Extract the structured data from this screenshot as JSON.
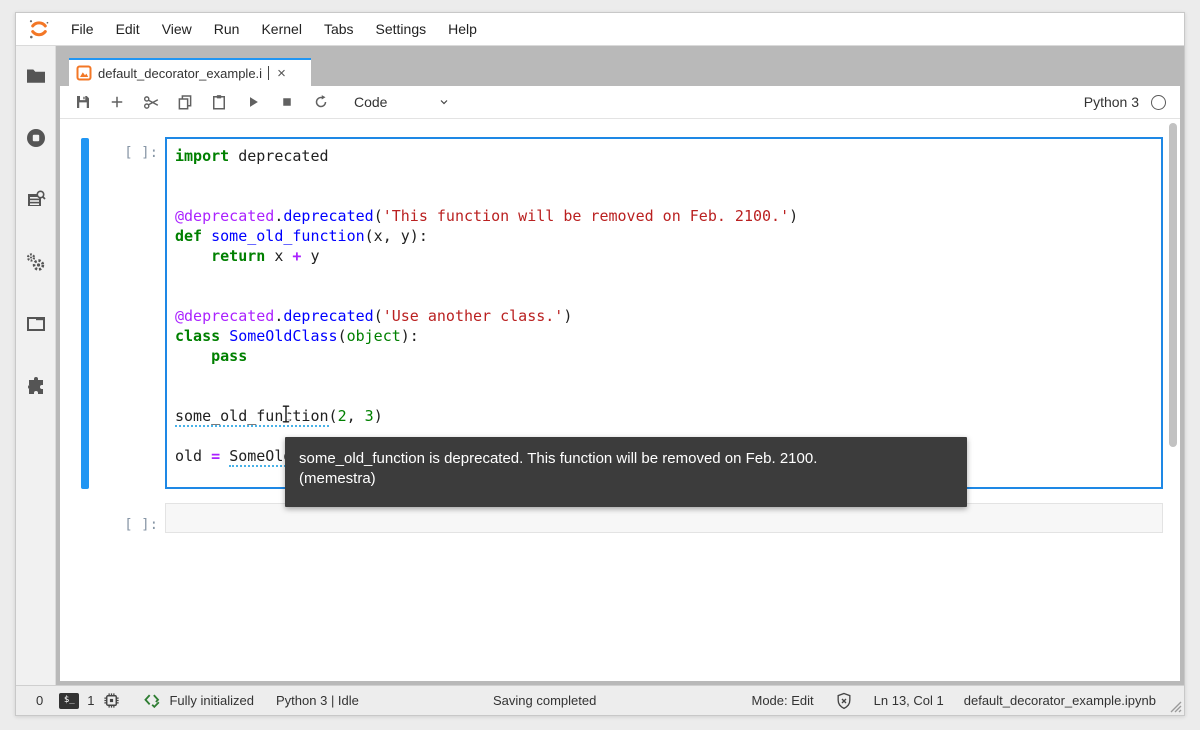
{
  "menubar": {
    "items": [
      "File",
      "Edit",
      "View",
      "Run",
      "Kernel",
      "Tabs",
      "Settings",
      "Help"
    ]
  },
  "tab": {
    "title": "default_decorator_example.i",
    "close": "×"
  },
  "toolbar": {
    "cell_type": "Code",
    "kernel_name": "Python 3",
    "icon_names": [
      "save",
      "insert-cell",
      "cut",
      "copy",
      "paste",
      "run",
      "stop",
      "restart-kernel"
    ]
  },
  "sidebar": {
    "icon_names": [
      "file-browser",
      "running-kernels",
      "inspector",
      "property-inspector",
      "open-tabs",
      "extensions"
    ]
  },
  "notebook": {
    "cells": [
      {
        "prompt": "[ ]:",
        "lines": [
          [
            {
              "t": "import",
              "c": "kw"
            },
            {
              "t": " deprecated",
              "c": "p"
            }
          ],
          [],
          [],
          [
            {
              "t": "@deprecated",
              "c": "dec"
            },
            {
              "t": ".",
              "c": "p"
            },
            {
              "t": "deprecated",
              "c": "d"
            },
            {
              "t": "(",
              "c": "p"
            },
            {
              "t": "'This function will be removed on Feb. 2100.'",
              "c": "s"
            },
            {
              "t": ")",
              "c": "p"
            }
          ],
          [
            {
              "t": "def",
              "c": "kw"
            },
            {
              "t": " ",
              "c": "p"
            },
            {
              "t": "some_old_function",
              "c": "d"
            },
            {
              "t": "(x, y):",
              "c": "p"
            }
          ],
          [
            {
              "t": "    ",
              "c": "p"
            },
            {
              "t": "return",
              "c": "kw"
            },
            {
              "t": " x ",
              "c": "p"
            },
            {
              "t": "+",
              "c": "o"
            },
            {
              "t": " y",
              "c": "p"
            }
          ],
          [],
          [],
          [
            {
              "t": "@deprecated",
              "c": "dec"
            },
            {
              "t": ".",
              "c": "p"
            },
            {
              "t": "deprecated",
              "c": "d"
            },
            {
              "t": "(",
              "c": "p"
            },
            {
              "t": "'Use another class.'",
              "c": "s"
            },
            {
              "t": ")",
              "c": "p"
            }
          ],
          [
            {
              "t": "class",
              "c": "kw"
            },
            {
              "t": " ",
              "c": "p"
            },
            {
              "t": "SomeOldClass",
              "c": "d"
            },
            {
              "t": "(",
              "c": "p"
            },
            {
              "t": "object",
              "c": "b"
            },
            {
              "t": "):",
              "c": "p"
            }
          ],
          [
            {
              "t": "    ",
              "c": "p"
            },
            {
              "t": "pass",
              "c": "kw"
            }
          ],
          [],
          [],
          [
            {
              "t": "some_old_function",
              "c": "pw"
            },
            {
              "t": "(",
              "c": "p"
            },
            {
              "t": "2",
              "c": "n"
            },
            {
              "t": ", ",
              "c": "p"
            },
            {
              "t": "3",
              "c": "n"
            },
            {
              "t": ")",
              "c": "p"
            }
          ],
          [],
          [
            {
              "t": "old ",
              "c": "p"
            },
            {
              "t": "=",
              "c": "o"
            },
            {
              "t": " ",
              "c": "p"
            },
            {
              "t": "SomeOldClass",
              "c": "pw"
            },
            {
              "t": "()",
              "c": "p"
            }
          ]
        ]
      },
      {
        "prompt": "[ ]:",
        "value": ""
      }
    ]
  },
  "tooltip": {
    "line1": "some_old_function is deprecated. This function will be removed on Feb. 2100.",
    "line2": "(memestra)"
  },
  "statusbar": {
    "terminals": "0",
    "kernels": "1",
    "lsp": "Fully initialized",
    "kernel_status": "Python 3 | Idle",
    "center": "Saving completed",
    "mode": "Mode: Edit",
    "position": "Ln 13, Col 1",
    "filename": "default_decorator_example.ipynb"
  },
  "colors": {
    "accent_blue": "#2196f3",
    "jupyter_orange": "#f37726",
    "syntax_keyword": "#008000",
    "syntax_string": "#ba2121",
    "syntax_operator": "#aa22ff",
    "syntax_name": "#0000ff",
    "lsp_green": "#2e7d32",
    "tooltip_bg": "#3c3c3c"
  }
}
